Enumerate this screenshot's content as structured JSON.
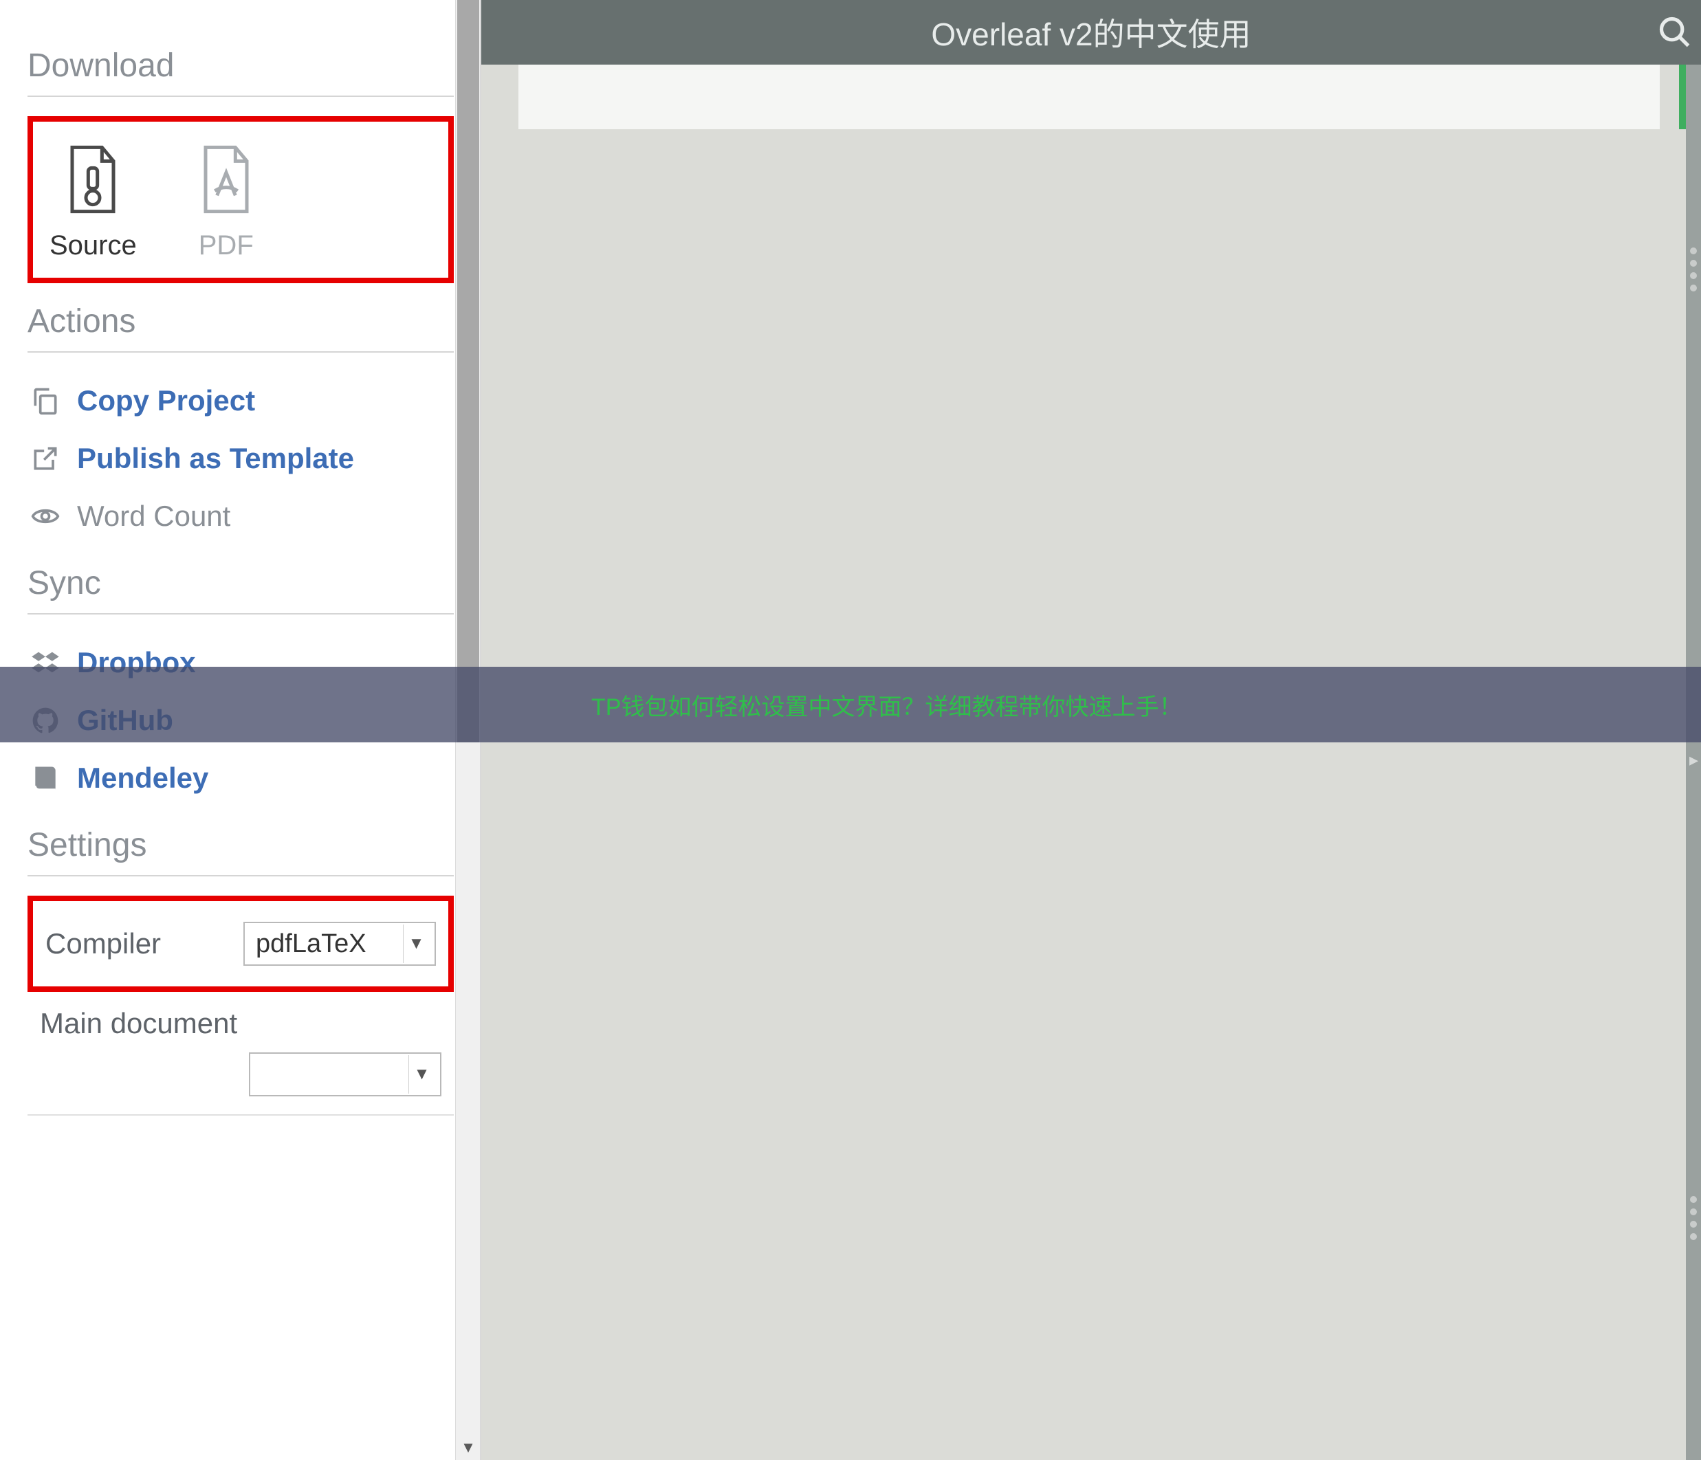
{
  "sidebar": {
    "download": {
      "heading": "Download",
      "source_label": "Source",
      "pdf_label": "PDF"
    },
    "actions": {
      "heading": "Actions",
      "copy_project": "Copy Project",
      "publish_template": "Publish as Template",
      "word_count": "Word Count"
    },
    "sync": {
      "heading": "Sync",
      "dropbox": "Dropbox",
      "github": "GitHub",
      "mendeley": "Mendeley"
    },
    "settings": {
      "heading": "Settings",
      "compiler_label": "Compiler",
      "compiler_value": "pdfLaTeX",
      "main_document_label": "Main document",
      "main_document_value": ""
    }
  },
  "main": {
    "title": "Overleaf v2的中文使用"
  },
  "banner": {
    "text": "TP钱包如何轻松设置中文界面？详细教程带你快速上手！"
  },
  "colors": {
    "highlight_border": "#e60000",
    "topbar_bg": "#67706f",
    "link_color": "#3d6db5",
    "banner_text": "#2fbf4a"
  }
}
